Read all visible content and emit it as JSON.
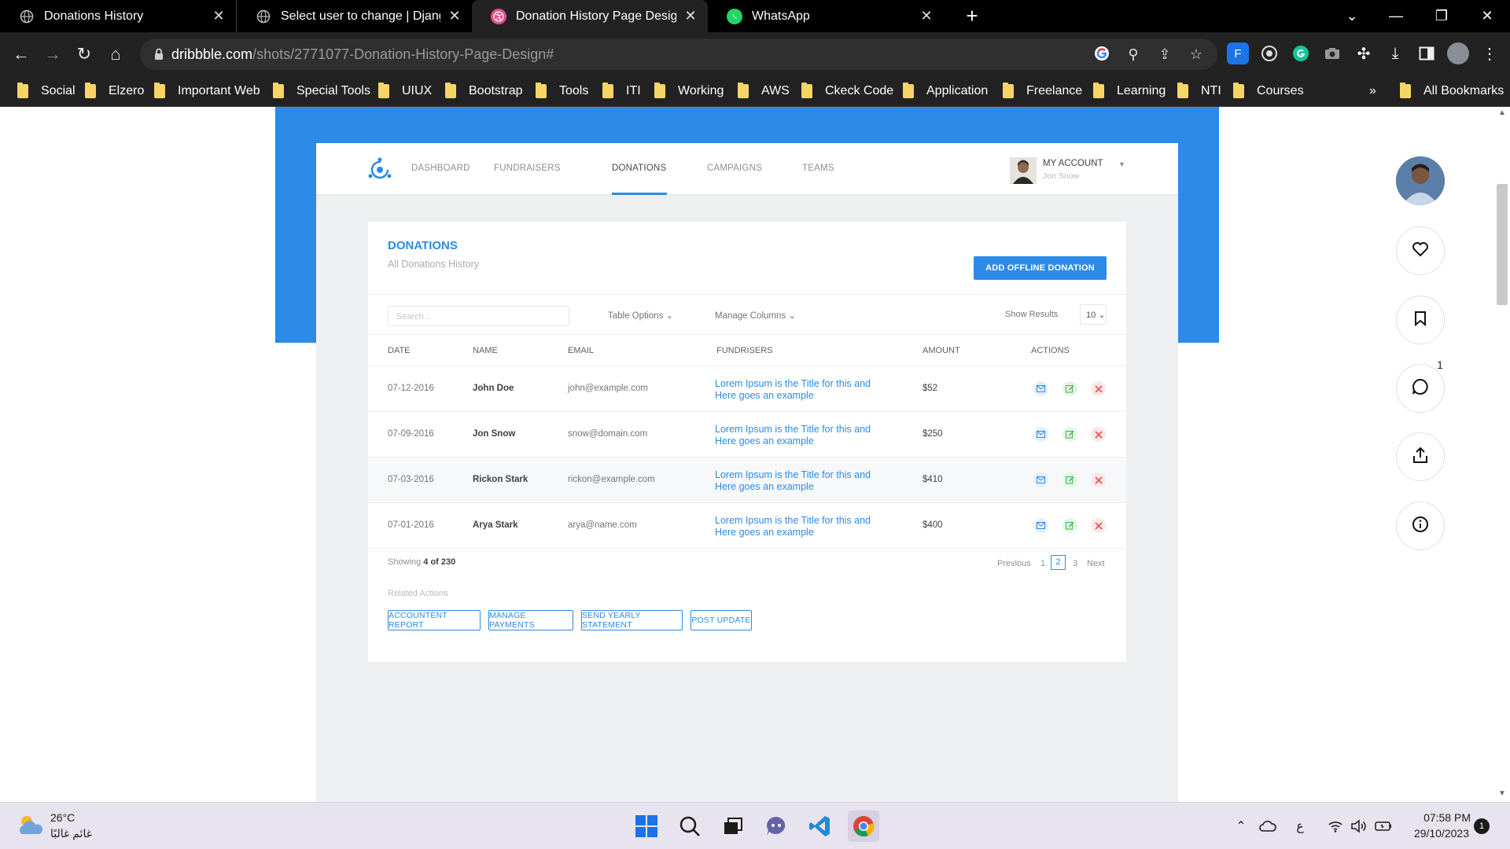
{
  "browser": {
    "tabs": [
      {
        "title": "Donations History",
        "icon": "globe-icon",
        "active": false
      },
      {
        "title": "Select user to change | Django s",
        "icon": "globe-icon",
        "active": false
      },
      {
        "title": "Donation History Page Design b",
        "icon": "dribbble-icon",
        "active": true
      },
      {
        "title": "WhatsApp",
        "icon": "whatsapp-icon",
        "active": false
      }
    ],
    "url_domain": "dribbble.com",
    "url_path": "/shots/2771077-Donation-History-Page-Design#",
    "bookmarks": [
      "Social",
      "Elzero",
      "Important Web",
      "Special Tools",
      "UIUX",
      "Bootstrap",
      "Tools",
      "ITI",
      "Working",
      "AWS",
      "Ckeck Code",
      "Application",
      "Freelance",
      "Learning",
      "NTI",
      "Courses"
    ],
    "bookmarks_overflow": "»",
    "all_bookmarks": "All Bookmarks",
    "extension_label": "F"
  },
  "app": {
    "nav": [
      "DASHBOARD",
      "FUNDRAISERS",
      "DONATIONS",
      "CAMPAIGNS",
      "TEAMS"
    ],
    "active_nav": "DONATIONS",
    "account_label": "MY ACCOUNT",
    "account_user": "Jon Snow",
    "title": "DONATIONS",
    "subtitle": "All Donations History",
    "add_button": "ADD OFFLINE DONATION",
    "search_placeholder": "Search...",
    "table_options": "Table Options",
    "manage_columns": "Manage Columns",
    "show_results": "Show Results",
    "page_size": "10",
    "columns": [
      "DATE",
      "NAME",
      "EMAIL",
      "FUNDRISERS",
      "AMOUNT",
      "ACTIONS"
    ],
    "rows": [
      {
        "date": "07-12-2016",
        "name": "John Doe",
        "email": "john@example.com",
        "fundraiser": "Lorem Ipsum is the Title for this and Here goes an example",
        "amount": "$52"
      },
      {
        "date": "07-09-2016",
        "name": "Jon Snow",
        "email": "snow@domain.com",
        "fundraiser": "Lorem Ipsum is the Title for this and Here goes an example",
        "amount": "$250"
      },
      {
        "date": "07-03-2016",
        "name": "Rickon Stark",
        "email": "rickon@example.com",
        "fundraiser": "Lorem Ipsum is the Title for this and Here goes an example",
        "amount": "$410"
      },
      {
        "date": "07-01-2016",
        "name": "Arya Stark",
        "email": "arya@name.com",
        "fundraiser": "Lorem Ipsum is the Title for this and Here goes an example",
        "amount": "$400"
      }
    ],
    "showing_prefix": "Showing ",
    "showing_count": "4 of 230",
    "pagination": {
      "previous": "Previous",
      "pages": [
        "1",
        "2",
        "3"
      ],
      "current": "2",
      "next": "Next"
    },
    "related_title": "Related Actions",
    "related_actions": [
      "ACCOUNTENT REPORT",
      "MANAGE PAYMENTS",
      "SEND YEARLY STATEMENT",
      "POST UPDATE"
    ]
  },
  "dribbble_rail": {
    "comment_count": "1",
    "buttons": [
      "heart-icon",
      "bookmark-icon",
      "comment-icon",
      "share-icon",
      "info-icon"
    ]
  },
  "taskbar": {
    "temperature": "26°C",
    "weather": "غائم غالبًا",
    "time": "07:58 PM",
    "date": "29/10/2023",
    "notifications": "1",
    "keyboard": "ع"
  },
  "colors": {
    "accent": "#2b8be6",
    "chrome_dark": "#222222",
    "folder": "#f5d565"
  }
}
